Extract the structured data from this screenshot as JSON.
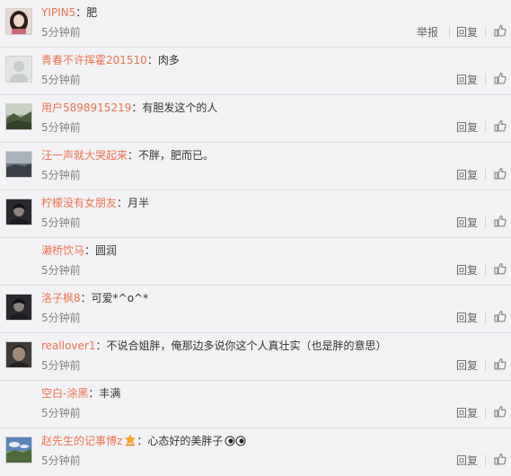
{
  "separator": "：",
  "actions": {
    "report_label": "举报",
    "reply_label": "回复"
  },
  "icons": {
    "like": "thumbs-up-icon"
  },
  "colors": {
    "username": "#eb7350",
    "text": "#333333",
    "meta": "#808080",
    "background": "#f2f2f5"
  },
  "comments": [
    {
      "user": "YIPIN5",
      "text": "肥",
      "time": "5分钟前",
      "show_report": true,
      "avatar": "girl-long-hair"
    },
    {
      "user": "青春不许挥霍201510",
      "text": "肉多",
      "time": "5分钟前",
      "show_report": false,
      "avatar": "default-gray"
    },
    {
      "user": "用户5898915219",
      "text": "有胆发这个的人",
      "time": "5分钟前",
      "show_report": false,
      "avatar": "landscape-hills"
    },
    {
      "user": "汪一声就大哭起来",
      "text": "不胖，肥而已。",
      "time": "5分钟前",
      "show_report": false,
      "avatar": "landscape-dusk"
    },
    {
      "user": "柠檬没有女朋友",
      "text": "月半",
      "time": "5分钟前",
      "show_report": false,
      "avatar": "dark-portrait"
    },
    {
      "user": "濑桥饮马",
      "text": "圆润",
      "time": "5分钟前",
      "show_report": false,
      "avatar": "none"
    },
    {
      "user": "洛子枫8",
      "text": "可爱*^o^*",
      "time": "5分钟前",
      "show_report": false,
      "avatar": "dark-portrait"
    },
    {
      "user": "reallover1",
      "text": "不说合姐胖，俺那边多说你这个人真壮实（也是胖的意思）",
      "time": "5分钟前",
      "show_report": false,
      "avatar": "dark-face"
    },
    {
      "user": "空白-涂黑",
      "text": "丰满",
      "time": "5分钟前",
      "show_report": false,
      "avatar": "none"
    },
    {
      "user": "赵先生的记事博z",
      "text": "心态好的美胖子",
      "time": "5分钟前",
      "show_report": false,
      "avatar": "landscape-sky",
      "badge": "member-badge-icon",
      "emoji": "eyes-emoji-icon"
    }
  ]
}
